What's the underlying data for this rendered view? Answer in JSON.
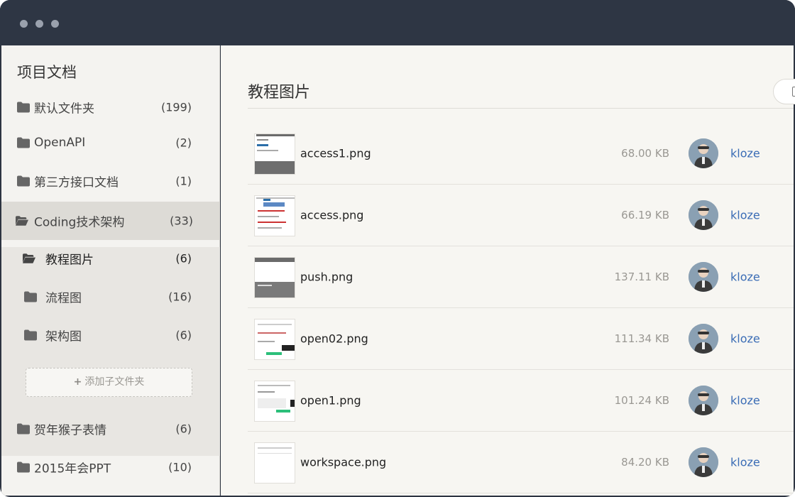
{
  "window": {
    "dots": [
      "close",
      "minimize",
      "maximize"
    ]
  },
  "sidebar": {
    "title": "项目文档",
    "folders_top": [
      {
        "name": "默认文件夹",
        "count": "(199)",
        "icon": "folder-icon"
      },
      {
        "name": "OpenAPI",
        "count": "(2)",
        "icon": "folder-icon"
      },
      {
        "name": "第三方接口文档",
        "count": "(1)",
        "icon": "folder-icon"
      }
    ],
    "expanded": {
      "name": "Coding技术架构",
      "count": "(33)",
      "icon": "folder-open-icon",
      "children": [
        {
          "name": "教程图片",
          "count": "(6)",
          "icon": "folder-open-icon",
          "active": true
        },
        {
          "name": "流程图",
          "count": "(16)",
          "icon": "folder-icon"
        },
        {
          "name": "架构图",
          "count": "(6)",
          "icon": "folder-icon"
        }
      ],
      "add_label": "添加子文件夹"
    },
    "folders_bottom": [
      {
        "name": "贺年猴子表情",
        "count": "(6)",
        "icon": "folder-icon"
      },
      {
        "name": "2015年会PPT",
        "count": "(10)",
        "icon": "folder-icon"
      }
    ]
  },
  "main": {
    "title": "教程图片",
    "files": [
      {
        "name": "access1.png",
        "size": "68.00 KB",
        "owner": "kloze"
      },
      {
        "name": "access.png",
        "size": "66.19 KB",
        "owner": "kloze"
      },
      {
        "name": "push.png",
        "size": "137.11 KB",
        "owner": "kloze"
      },
      {
        "name": "open02.png",
        "size": "111.34 KB",
        "owner": "kloze"
      },
      {
        "name": "open1.png",
        "size": "101.24 KB",
        "owner": "kloze"
      },
      {
        "name": "workspace.png",
        "size": "84.20 KB",
        "owner": "kloze"
      }
    ]
  },
  "colors": {
    "titlebar": "#2e3644",
    "sidebar_bg": "#f4f3f0",
    "active_bg": "#dddbd6",
    "link": "#3a6cb5"
  }
}
